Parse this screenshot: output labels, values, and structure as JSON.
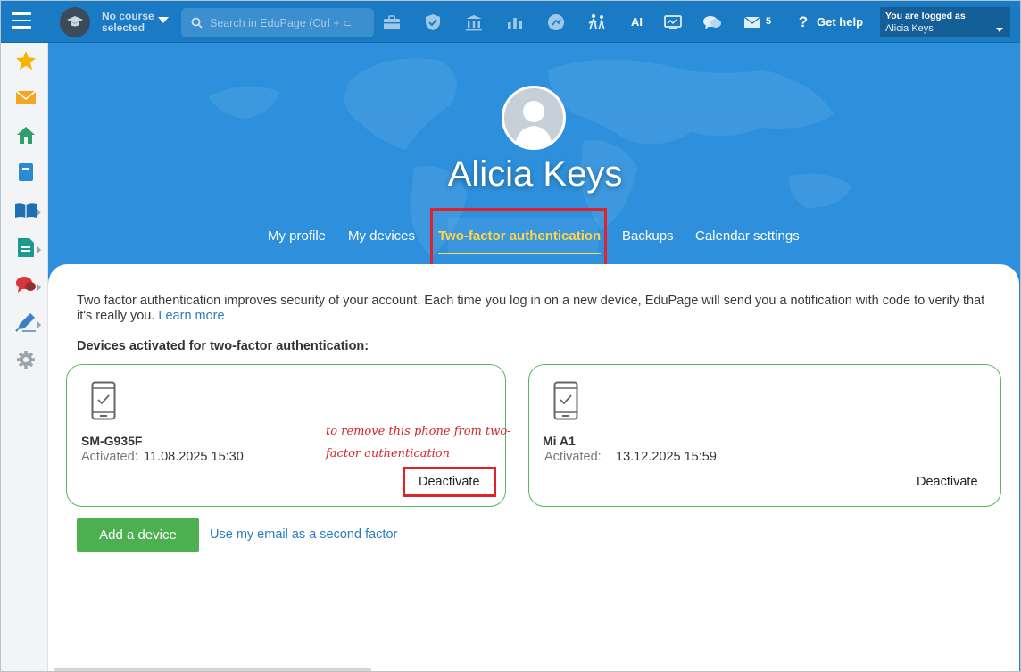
{
  "topbar": {
    "course_label": "No course selected",
    "search_placeholder": "Search in EduPage (Ctrl + ⊂",
    "ai_label": "AI",
    "messages_count": "5",
    "help_label": "Get help",
    "login_line1": "You are logged as",
    "login_line2": "Alicia Keys"
  },
  "profile": {
    "name": "Alicia Keys"
  },
  "tabs": [
    {
      "label": "My profile"
    },
    {
      "label": "My devices"
    },
    {
      "label": "Two-factor authentication",
      "active": true
    },
    {
      "label": "Backups"
    },
    {
      "label": "Calendar settings"
    }
  ],
  "content": {
    "intro_text": "Two factor authentication improves security of your account. Each time you log in on a new device, EduPage will send you a notification with code to verify that it's really you.",
    "learn_more": "Learn more",
    "section_title": "Devices activated for two-factor authentication:",
    "activated_label": "Activated:",
    "deactivate_label": "Deactivate",
    "devices": [
      {
        "name": "SM-G935F",
        "activated": "11.08.2025 15:30"
      },
      {
        "name": "Mi A1",
        "activated": "13.12.2025 15:59"
      }
    ],
    "annotation": "to remove this phone from two-factor authentication",
    "add_device_label": "Add a device",
    "email_factor_label": "Use my email as a second factor"
  },
  "colors": {
    "topbar": "#1a7bc4",
    "hero": "#2e90dc",
    "active_tab": "#ffd54a",
    "device_border": "#5cb85c",
    "add_button": "#4caf50",
    "link": "#2a7cc1",
    "highlight": "#e0222b"
  }
}
